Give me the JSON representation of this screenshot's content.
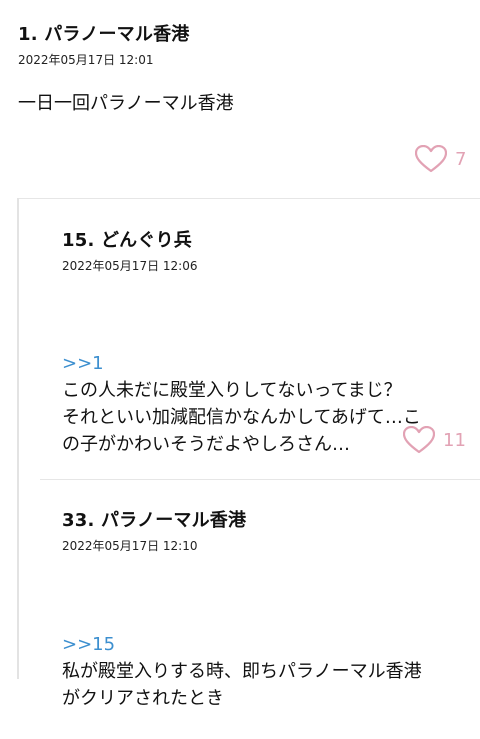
{
  "posts": [
    {
      "title": "1. パラノーマル香港",
      "date": "2022年05月17日 12:01",
      "body": "一日一回パラノーマル香港",
      "likes": "7"
    },
    {
      "title": "15. どんぐり兵",
      "date": "2022年05月17日 12:06",
      "anchor": ">>1",
      "body": "この人未だに殿堂入りしてないってまじ？\nそれといい加減配信かなんかしてあげて…こ\nの子がかわいそうだよやしろさん…",
      "likes": "11"
    },
    {
      "title": "33. パラノーマル香港",
      "date": "2022年05月17日 12:10",
      "anchor": ">>15",
      "body": "私が殿堂入りする時、即ちパラノーマル香港\nがクリアされたとき"
    }
  ],
  "icons": {
    "like": "heart-outline-icon"
  },
  "colors": {
    "heart": "#e2a2b4",
    "anchor": "#3c8fcf",
    "divider": "#e6e6e6"
  }
}
